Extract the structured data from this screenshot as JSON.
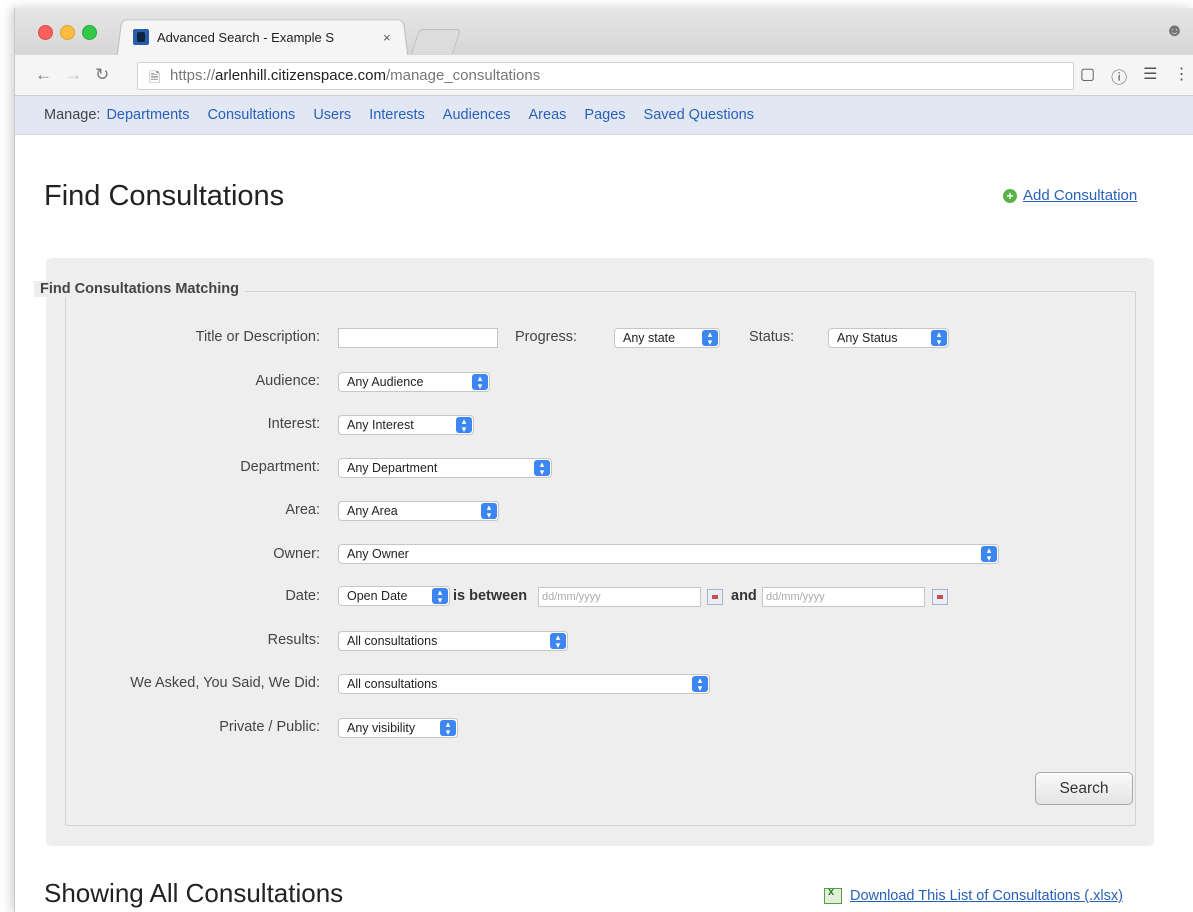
{
  "browser": {
    "tab_title": "Advanced Search - Example S",
    "tab_close": "×",
    "url_prefix": "https://",
    "url_host": "arlenhill.citizenspace.com",
    "url_path": "/manage_consultations"
  },
  "manage_bar": {
    "label": "Manage:",
    "links": [
      "Departments",
      "Consultations",
      "Users",
      "Interests",
      "Audiences",
      "Areas",
      "Pages",
      "Saved Questions"
    ]
  },
  "page": {
    "title": "Find Consultations",
    "add_link": "Add Consultation",
    "subtitle": "Showing All Consultations",
    "download_link": "Download This List of Consultations (.xlsx)"
  },
  "form": {
    "legend": "Find Consultations Matching",
    "title_label": "Title or Description:",
    "title_value": "",
    "progress_label": "Progress:",
    "progress_value": "Any state",
    "status_label": "Status:",
    "status_value": "Any Status",
    "audience_label": "Audience:",
    "audience_value": "Any Audience",
    "interest_label": "Interest:",
    "interest_value": "Any Interest",
    "department_label": "Department:",
    "department_value": "Any Department",
    "area_label": "Area:",
    "area_value": "Any Area",
    "owner_label": "Owner:",
    "owner_value": "Any Owner",
    "date_label": "Date:",
    "date_type_value": "Open Date",
    "is_between": "is between",
    "and": "and",
    "date_placeholder": "dd/mm/yyyy",
    "results_label": "Results:",
    "results_value": "All consultations",
    "wayswd_label": "We Asked, You Said, We Did:",
    "wayswd_value": "All consultations",
    "visibility_label": "Private / Public:",
    "visibility_value": "Any visibility",
    "search_button": "Search"
  }
}
